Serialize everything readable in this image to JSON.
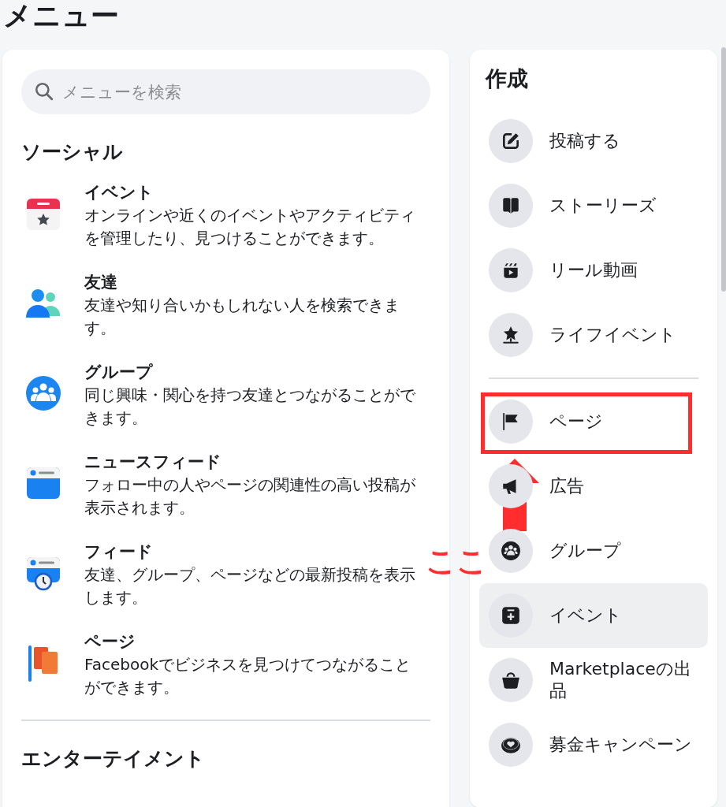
{
  "page_title": "メニュー",
  "search": {
    "placeholder": "メニューを検索"
  },
  "social": {
    "heading": "ソーシャル",
    "items": [
      {
        "title": "イベント",
        "description": "オンラインや近くのイベントやアクティビティを管理したり、見つけることができます。"
      },
      {
        "title": "友達",
        "description": "友達や知り合いかもしれない人を検索できます。"
      },
      {
        "title": "グループ",
        "description": "同じ興味・関心を持つ友達とつながることができます。"
      },
      {
        "title": "ニュースフィード",
        "description": "フォロー中の人やページの関連性の高い投稿が表示されます。"
      },
      {
        "title": "フィード",
        "description": "友達、グループ、ページなどの最新投稿を表示します。"
      },
      {
        "title": "ページ",
        "description": "Facebookでビジネスを見つけてつながることができます。"
      }
    ]
  },
  "entertainment": {
    "heading": "エンターテイメント"
  },
  "create": {
    "heading": "作成",
    "sections": [
      {
        "items": [
          {
            "label": "投稿する",
            "highlighted": false,
            "marked": false
          },
          {
            "label": "ストーリーズ",
            "highlighted": false,
            "marked": false
          },
          {
            "label": "リール動画",
            "highlighted": false,
            "marked": false
          },
          {
            "label": "ライフイベント",
            "highlighted": false,
            "marked": false
          }
        ]
      },
      {
        "items": [
          {
            "label": "ページ",
            "highlighted": false,
            "marked": true
          },
          {
            "label": "広告",
            "highlighted": false,
            "marked": false
          },
          {
            "label": "グループ",
            "highlighted": false,
            "marked": false
          },
          {
            "label": "イベント",
            "highlighted": true,
            "marked": false
          },
          {
            "label": "Marketplaceの出品",
            "highlighted": false,
            "marked": false
          },
          {
            "label": "募金キャンペーン",
            "highlighted": false,
            "marked": false
          }
        ]
      }
    ]
  },
  "annotation": {
    "text": "ここ"
  }
}
